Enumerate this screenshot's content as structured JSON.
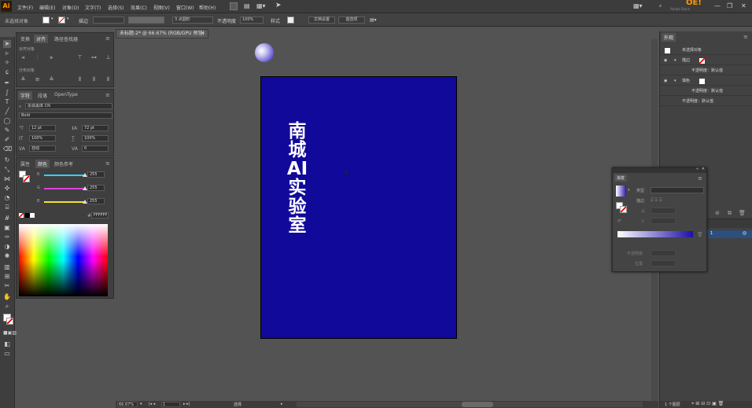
{
  "app": {
    "logo": "Ai",
    "brand": "Adobe Stock",
    "accent": "#ff9a00"
  },
  "menu": [
    {
      "label": "文件(F)"
    },
    {
      "label": "编辑(E)"
    },
    {
      "label": "对象(O)"
    },
    {
      "label": "文字(T)"
    },
    {
      "label": "选择(S)"
    },
    {
      "label": "效果(C)"
    },
    {
      "label": "视图(V)"
    },
    {
      "label": "窗口(W)"
    },
    {
      "label": "帮助(H)"
    }
  ],
  "control_bar": {
    "selection_state": "未选择对象",
    "stroke_label": "描边",
    "stroke_weight": "3 点圆形",
    "opacity_label": "不透明度",
    "opacity_value": "100%",
    "style_label": "样式",
    "doc_setup": "文档设置",
    "preferences": "首选项"
  },
  "document": {
    "tab_title": "未标题-2* @ 66.67% (RGB/GPU 预览)",
    "artboard_color": "#11099a",
    "vertical_text": "南城AI实验室"
  },
  "align_panel": {
    "tabs": [
      "变换",
      "对齐",
      "路径查找器"
    ],
    "align_objects": "对齐对象",
    "distribute_objects": "分布对象"
  },
  "char_panel": {
    "tabs": [
      "字符",
      "段落",
      "OpenType"
    ],
    "font_family": "思源黑体 CN",
    "font_style": "Bold",
    "font_size": "12 pt",
    "leading": "72 pt",
    "scale_v": "100%",
    "scale_h": "100%",
    "kerning": "自动",
    "tracking": "0"
  },
  "color_panel": {
    "tabs": [
      "属性",
      "颜色",
      "颜色参考"
    ],
    "channels": [
      {
        "name": "R",
        "value": "255",
        "color": "#2ad4ff"
      },
      {
        "name": "G",
        "value": "255",
        "color": "#e040e0"
      },
      {
        "name": "B",
        "value": "255",
        "color": "#f5e030"
      }
    ],
    "hex": "FFFFFF"
  },
  "appearance_panel": {
    "title": "外观",
    "no_selection": "未选择对象",
    "stroke": "描边",
    "opacity_default": "不透明度：默认值",
    "fill": "填色"
  },
  "gradient_panel": {
    "title": "渐变",
    "type_label": "类型",
    "stroke_label": "描边",
    "opacity_label": "不透明度",
    "location_label": "位置"
  },
  "layers": {
    "count": "1 个图层"
  },
  "status": {
    "zoom": "66.67%",
    "artboard": "1",
    "tool": "选择"
  }
}
